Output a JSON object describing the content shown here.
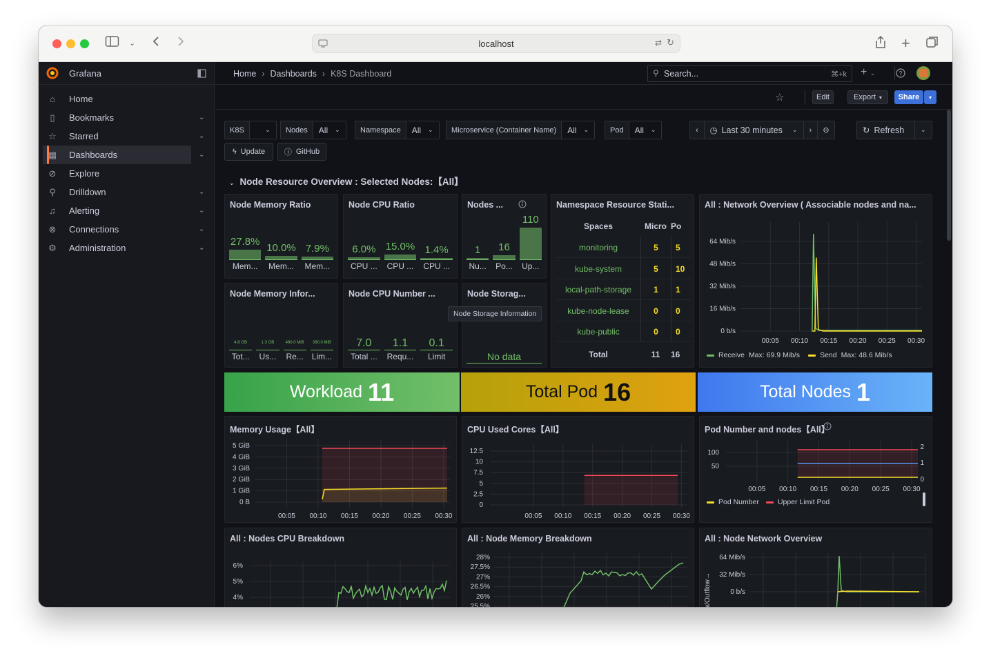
{
  "browser": {
    "url": "localhost"
  },
  "brand": {
    "name": "Grafana"
  },
  "sidebar": {
    "items": [
      {
        "label": "Home",
        "icon": "home-icon",
        "chev": false
      },
      {
        "label": "Bookmarks",
        "icon": "bookmark-icon",
        "chev": true
      },
      {
        "label": "Starred",
        "icon": "star-icon",
        "chev": true
      },
      {
        "label": "Dashboards",
        "icon": "dashboards-icon",
        "chev": true,
        "active": true
      },
      {
        "label": "Explore",
        "icon": "compass-icon",
        "chev": false
      },
      {
        "label": "Drilldown",
        "icon": "drilldown-icon",
        "chev": true
      },
      {
        "label": "Alerting",
        "icon": "bell-icon",
        "chev": true
      },
      {
        "label": "Connections",
        "icon": "connections-icon",
        "chev": true
      },
      {
        "label": "Administration",
        "icon": "gear-icon",
        "chev": true
      }
    ]
  },
  "breadcrumb": {
    "home": "Home",
    "dashboards": "Dashboards",
    "current": "K8S Dashboard"
  },
  "search": {
    "placeholder": "Search...",
    "shortcut": "⌘+k"
  },
  "toolbar": {
    "edit": "Edit",
    "export": "Export",
    "share": "Share"
  },
  "variables": {
    "k8s": {
      "label": "K8S",
      "value": ""
    },
    "nodes": {
      "label": "Nodes",
      "value": "All"
    },
    "namespace": {
      "label": "Namespace",
      "value": "All"
    },
    "microservice": {
      "label": "Microservice (Container Name)",
      "value": "All"
    },
    "pod": {
      "label": "Pod",
      "value": "All"
    }
  },
  "time": {
    "range": "Last 30 minutes",
    "refresh": "Refresh"
  },
  "links": {
    "update": "Update",
    "github": "GitHub"
  },
  "row": {
    "title": "Node Resource Overview : Selected Nodes:【All】"
  },
  "panels": {
    "mem_ratio": {
      "title": "Node Memory Ratio",
      "stats": [
        {
          "v": "27.8%",
          "l": "Mem...",
          "fill": 0.278
        },
        {
          "v": "10.0%",
          "l": "Mem...",
          "fill": 0.1
        },
        {
          "v": "7.9%",
          "l": "Mem...",
          "fill": 0.079
        }
      ]
    },
    "cpu_ratio": {
      "title": "Node CPU Ratio",
      "stats": [
        {
          "v": "6.0%",
          "l": "CPU ...",
          "fill": 0.06
        },
        {
          "v": "15.0%",
          "l": "CPU ...",
          "fill": 0.15
        },
        {
          "v": "1.4%",
          "l": "CPU ...",
          "fill": 0.014
        }
      ]
    },
    "nodes": {
      "title": "Nodes ...",
      "stats": [
        {
          "v": "1",
          "l": "Nu...",
          "fill": 0.01
        },
        {
          "v": "16",
          "l": "Po...",
          "fill": 0.14
        },
        {
          "v": "110",
          "l": "Up...",
          "fill": 1.0
        }
      ]
    },
    "ns_stats": {
      "title": "Namespace Resource Stati...",
      "headers": [
        "Spaces",
        "Micro",
        "Po"
      ],
      "rows": [
        [
          "monitoring",
          "5",
          "5"
        ],
        [
          "kube-system",
          "5",
          "10"
        ],
        [
          "local-path-storage",
          "1",
          "1"
        ],
        [
          "kube-node-lease",
          "0",
          "0"
        ],
        [
          "kube-public",
          "0",
          "0"
        ]
      ],
      "total": [
        "Total",
        "11",
        "16"
      ]
    },
    "net_overview": {
      "title": "All : Network Overview ( Associable nodes and na...",
      "yticks": [
        "64 Mib/s",
        "48 Mib/s",
        "32 Mib/s",
        "16 Mib/s",
        "0 b/s"
      ],
      "legend": [
        {
          "name": "Receive",
          "stat": "Max: 69.9 Mib/s"
        },
        {
          "name": "Send",
          "stat": "Max: 48.6 Mib/s"
        }
      ]
    },
    "mem_info": {
      "title": "Node Memory Infor...",
      "stats": [
        {
          "v": "4.8 GB",
          "l": "Tot..."
        },
        {
          "v": "1.3 GB",
          "l": "Us..."
        },
        {
          "v": "490.0 MiB",
          "l": "Re..."
        },
        {
          "v": "390.0 MiB",
          "l": "Lim..."
        }
      ]
    },
    "cpu_num": {
      "title": "Node CPU Number ...",
      "stats": [
        {
          "v": "7.0",
          "l": "Total ..."
        },
        {
          "v": "1.1",
          "l": "Requ..."
        },
        {
          "v": "0.1",
          "l": "Limit"
        }
      ]
    },
    "storage": {
      "title": "Node Storag...",
      "tooltip": "Node Storage Information",
      "nodata": "No data"
    },
    "mem_usage": {
      "title": "Memory Usage【All】",
      "yticks": [
        "5 GiB",
        "4 GiB",
        "3 GiB",
        "2 GiB",
        "1 GiB",
        "0 B"
      ]
    },
    "cpu_used": {
      "title": "CPU Used Cores【All】",
      "yticks": [
        "12.5",
        "10",
        "7.5",
        "5",
        "2.5",
        "0"
      ]
    },
    "pod_number": {
      "title": "Pod Number and nodes【All】",
      "yleft": [
        "100",
        "50"
      ],
      "yright": [
        "2",
        "1",
        "0"
      ],
      "legend": [
        "Pod Number",
        "Upper Limit Pod"
      ]
    },
    "cpu_breakdown": {
      "title": "All : Nodes CPU Breakdown",
      "yticks": [
        "6%",
        "5%",
        "4%"
      ]
    },
    "mem_breakdown": {
      "title": "All : Node Memory Breakdown",
      "yticks": [
        "28%",
        "27.5%",
        "27%",
        "26.5%",
        "26%",
        "25.5%"
      ]
    },
    "net_node": {
      "title": "All : Node Network Overview",
      "yticks": [
        "64 Mib/s",
        "32 Mib/s",
        "0 b/s"
      ],
      "ylabel": "w/Outflow→"
    }
  },
  "xticks": [
    "00:05",
    "00:10",
    "00:15",
    "00:20",
    "00:25",
    "00:30"
  ],
  "tiles": [
    {
      "name": "Workload",
      "value": "11"
    },
    {
      "name": "Total Pod",
      "value": "16"
    },
    {
      "name": "Total Nodes",
      "value": "1"
    }
  ],
  "colors": {
    "green": "#73bf69",
    "yellow": "#fade2a",
    "red": "#f2495c",
    "blue": "#5794f2",
    "orange": "#ff7a3d"
  }
}
